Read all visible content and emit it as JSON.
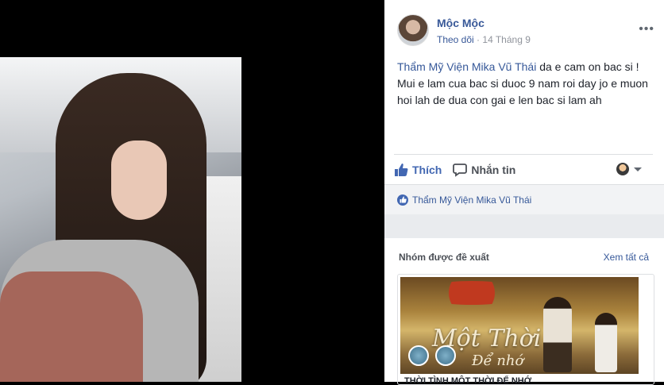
{
  "post": {
    "author": "Mộc Mộc",
    "follow_label": "Theo dõi",
    "separator": "·",
    "date": "14 Tháng 9",
    "more_icon": "more-icon",
    "tagged_page": "Thẩm Mỹ Viện Mika Vũ Thái",
    "text": " da e cam on bac si ! Mui e lam cua bac si duoc 9 nam roi day jo e muon hoi lah de dua con gai e len bac si lam ah"
  },
  "actions": {
    "like_label": "Thích",
    "message_label": "Nhắn tin"
  },
  "likes": {
    "name": "Thẩm Mỹ Viện Mika Vũ Thái"
  },
  "groups": {
    "heading": "Nhóm được đề xuất",
    "see_all": "Xem tất cả",
    "card_title_line1": "Một Thời",
    "card_title_line2": "Để nhớ",
    "card_footer": "THỜI TÌNH MỘT THỜI ĐỂ NHỚ"
  },
  "colors": {
    "link": "#385898",
    "like_blue": "#4267b2",
    "text": "#1d2129",
    "muted": "#90949c"
  }
}
